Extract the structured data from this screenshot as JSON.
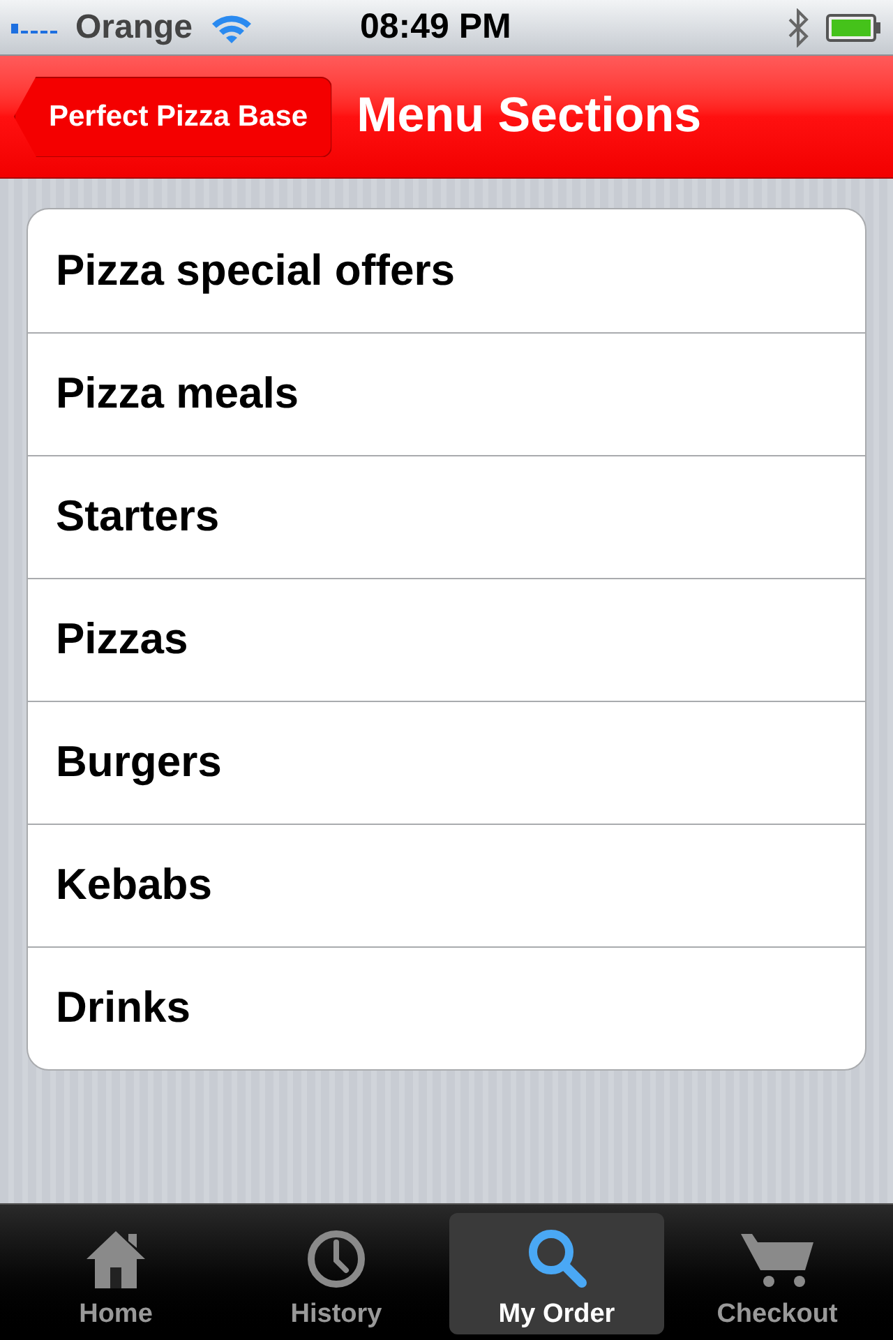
{
  "status_bar": {
    "carrier": "Orange",
    "time": "08:49 PM"
  },
  "nav_bar": {
    "back_button": "Perfect Pizza Base",
    "title": "Menu Sections"
  },
  "sections": [
    {
      "label": "Pizza special offers"
    },
    {
      "label": "Pizza meals"
    },
    {
      "label": "Starters"
    },
    {
      "label": "Pizzas"
    },
    {
      "label": "Burgers"
    },
    {
      "label": "Kebabs"
    },
    {
      "label": "Drinks"
    }
  ],
  "tab_bar": [
    {
      "label": "Home",
      "kind": "home",
      "selected": false
    },
    {
      "label": "History",
      "kind": "history",
      "selected": false
    },
    {
      "label": "My Order",
      "kind": "search",
      "selected": true
    },
    {
      "label": "Checkout",
      "kind": "cart",
      "selected": false
    }
  ]
}
